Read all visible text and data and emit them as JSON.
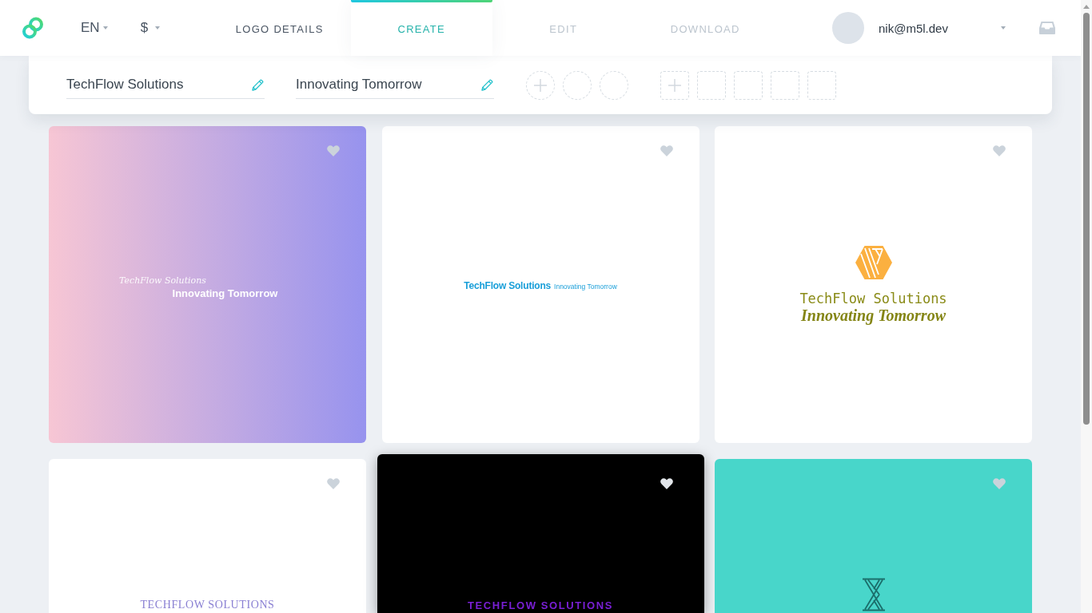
{
  "header": {
    "language": "EN",
    "currency": "$",
    "steps": [
      {
        "label": "LOGO DETAILS",
        "selected": false,
        "disabled": false
      },
      {
        "label": "CREATE",
        "selected": true,
        "disabled": false
      },
      {
        "label": "EDIT",
        "selected": false,
        "disabled": true
      },
      {
        "label": "DOWNLOAD",
        "selected": false,
        "disabled": true
      }
    ],
    "account": {
      "email": "nik@m5l.dev"
    }
  },
  "editor": {
    "company_name": "TechFlow Solutions",
    "slogan": "Innovating Tomorrow",
    "color_slots": [
      {
        "kind": "add"
      },
      {
        "kind": "empty"
      },
      {
        "kind": "empty"
      }
    ],
    "symbol_slots": [
      {
        "kind": "add"
      },
      {
        "kind": "empty"
      },
      {
        "kind": "empty"
      },
      {
        "kind": "empty"
      },
      {
        "kind": "empty"
      }
    ]
  },
  "logos": [
    {
      "kind": "gradient",
      "name": "TechFlow Solutions",
      "slogan": "Innovating Tomorrow",
      "liked": false,
      "hovered": false
    },
    {
      "kind": "inline",
      "name": "TechFlow Solutions",
      "slogan": "Innovating Tomorrow",
      "liked": false,
      "hovered": false
    },
    {
      "kind": "emblem",
      "name": "TechFlow Solutions",
      "slogan": "Innovating Tomorrow",
      "liked": false,
      "hovered": false
    },
    {
      "kind": "serif",
      "name": "TECHFLOW SOLUTIONS",
      "liked": false,
      "hovered": false
    },
    {
      "kind": "dark",
      "name": "TECHFLOW SOLUTIONS",
      "liked": false,
      "hovered": true
    },
    {
      "kind": "symbol",
      "liked": false,
      "hovered": false
    }
  ]
}
